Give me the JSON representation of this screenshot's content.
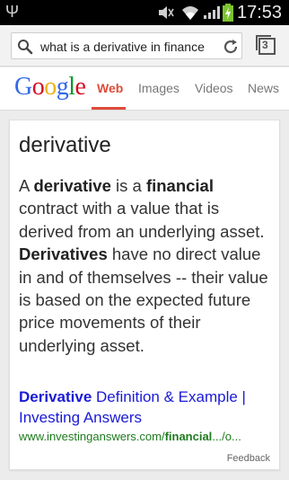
{
  "status_bar": {
    "time": "17:53",
    "icons": [
      "usb-icon",
      "mute-icon",
      "wifi-icon",
      "signal-icon",
      "battery-charging-icon"
    ],
    "battery_color": "#7cc32f"
  },
  "browser": {
    "url": "what is a derivative in finance",
    "tab_count": "3"
  },
  "google": {
    "logo": "Google",
    "tabs": [
      {
        "label": "Web",
        "active": true
      },
      {
        "label": "Images",
        "active": false
      },
      {
        "label": "Videos",
        "active": false
      },
      {
        "label": "News",
        "active": false
      }
    ],
    "accent_color": "#dd4b39"
  },
  "answer_card": {
    "title": "derivative",
    "definition": [
      {
        "text": "A ",
        "bold": false
      },
      {
        "text": "derivative",
        "bold": true
      },
      {
        "text": " is a ",
        "bold": false
      },
      {
        "text": "financial",
        "bold": true
      },
      {
        "text": " contract with a value that is derived from an underlying asset. ",
        "bold": false
      },
      {
        "text": "Derivatives",
        "bold": true
      },
      {
        "text": " have no direct value in and of themselves -- their value is based on the expected future price movements of their underlying asset.",
        "bold": false
      }
    ],
    "result_title_bold": "Derivative",
    "result_title_rest": " Definition & Example | Investing Answers",
    "result_url_prefix": "www.investinganswers.com/",
    "result_url_bold": "financial",
    "result_url_suffix": ".../o...",
    "feedback": "Feedback",
    "link_color": "#1a1ad6",
    "url_color": "#1e7a1e"
  }
}
